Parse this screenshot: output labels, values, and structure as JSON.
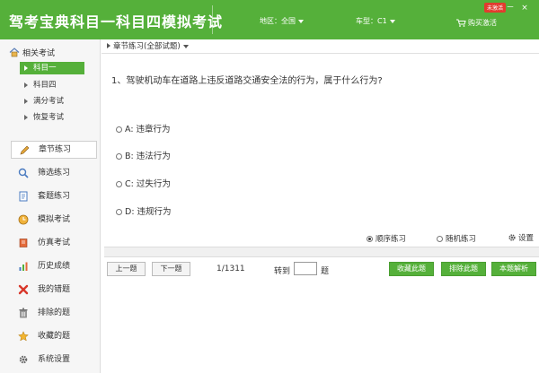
{
  "header": {
    "title": "驾考宝典科目一科目四模拟考试",
    "region_label": "地区：全国",
    "car_type_label": "车型：C1",
    "badge": "未激活",
    "buy_label": "购买激活",
    "window_buttons": [
      "－",
      "×"
    ]
  },
  "sidebar": {
    "heading": "相关考试",
    "sub_items": [
      "科目一",
      "科目四",
      "满分考试",
      "恢复考试"
    ],
    "nav_items": [
      "章节练习",
      "筛选练习",
      "套题练习",
      "模拟考试",
      "仿真考试",
      "历史成绩",
      "我的错题",
      "排除的题",
      "收藏的题",
      "系统设置"
    ]
  },
  "main": {
    "breadcrumb": "章节练习(全部试题)",
    "question": "1、驾驶机动车在道路上违反道路交通安全法的行为，属于什么行为?",
    "options": [
      "A: 违章行为",
      "B: 违法行为",
      "C: 过失行为",
      "D: 违规行为"
    ],
    "modes": [
      "顺序练习",
      "随机练习"
    ],
    "selected_mode": "顺序练习",
    "settings_label": "设置",
    "prev_label": "上一题",
    "next_label": "下一题",
    "counter": "1/1311",
    "goto_label": "转到",
    "goto_suffix": "题",
    "goto_value": "",
    "actions": [
      "收藏此题",
      "排除此题",
      "本题解析"
    ]
  },
  "colors": {
    "brand_green": "#55b03a",
    "badge_red": "#e23b2e"
  }
}
